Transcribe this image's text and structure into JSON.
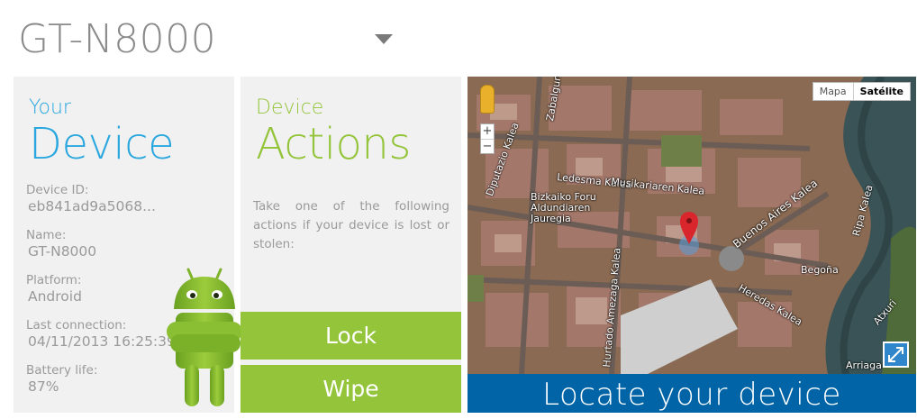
{
  "header": {
    "device_name": "GT-N8000",
    "dropdown_icon": "chevron-down-icon"
  },
  "device_panel": {
    "heading_small": "Your",
    "heading_big": "Device",
    "fields": [
      {
        "label": "Device ID:",
        "value": "eb841ad9a5068..."
      },
      {
        "label": "Name:",
        "value": "GT-N8000"
      },
      {
        "label": "Platform:",
        "value": "Android"
      },
      {
        "label": "Last connection:",
        "value": "04/11/2013 16:25:39"
      },
      {
        "label": "Battery life:",
        "value": "87%"
      }
    ],
    "mascot_icon": "android-robot-icon"
  },
  "actions_panel": {
    "heading_small": "Device",
    "heading_big": "Actions",
    "description": "Take one of the following actions if your device is lost or stolen:",
    "lock_label": "Lock",
    "wipe_label": "Wipe"
  },
  "map": {
    "type_map_label": "Mapa",
    "type_satellite_label": "Satélite",
    "zoom_in": "+",
    "zoom_out": "−",
    "labels": {
      "street_1": "Buenos Aires Kalea",
      "street_2": "Ripa Kalea",
      "street_3": "Hurtado Amezaga Kalea",
      "street_4": "Zabalgunea Plaza",
      "street_5": "Diputazio Kalea",
      "street_6": "Ledesma Kalea",
      "street_7": "Musikariaren Kalea",
      "poi_1": "Bizkaiko Foru Aldundiaren Jauregia",
      "poi_2": "Begoña",
      "poi_3": "Arriaga",
      "poi_4": "Heredas Kalea",
      "poi_5": "Atxuri"
    }
  },
  "locate_label": "Locate your device",
  "colors": {
    "blue_accent": "#2aa7de",
    "green_accent": "#93c43a",
    "locate_bar": "#0064a6",
    "panel_bg": "#f1f1f1"
  }
}
